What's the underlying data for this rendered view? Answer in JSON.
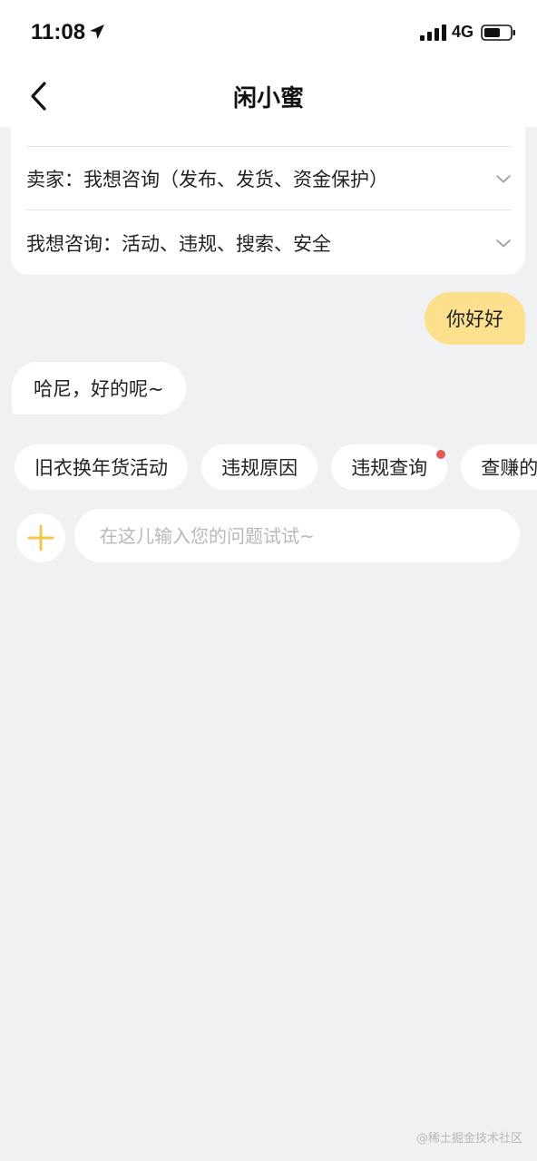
{
  "status_bar": {
    "time": "11:08",
    "network": "4G",
    "icons": [
      "location-arrow-icon",
      "signal-icon",
      "battery-icon"
    ]
  },
  "nav": {
    "title": "闲小蜜",
    "back_icon": "chevron-left-icon"
  },
  "faq": {
    "items": [
      {
        "label": "卖家：我想咨询（发布、发货、资金保护）",
        "icon": "chevron-down-icon"
      },
      {
        "label": "我想咨询：活动、违规、搜索、安全",
        "icon": "chevron-down-icon"
      }
    ]
  },
  "messages": [
    {
      "from": "user",
      "text": "你好好"
    },
    {
      "from": "bot",
      "text": "哈尼，好的呢~"
    }
  ],
  "quick_chips": [
    {
      "label": "旧衣换年货活动",
      "dot": false
    },
    {
      "label": "违规原因",
      "dot": false
    },
    {
      "label": "违规查询",
      "dot": true
    },
    {
      "label": "查赚的",
      "dot": false
    }
  ],
  "composer": {
    "add_icon": "plus-icon",
    "placeholder": "在这儿输入您的问题试试~"
  },
  "watermark": "@稀土掘金技术社区",
  "colors": {
    "page_bg": "#f0f1f3",
    "user_bubble": "#fde08d",
    "accent_plus": "#f5c84a",
    "notify_dot": "#e05a5a"
  }
}
